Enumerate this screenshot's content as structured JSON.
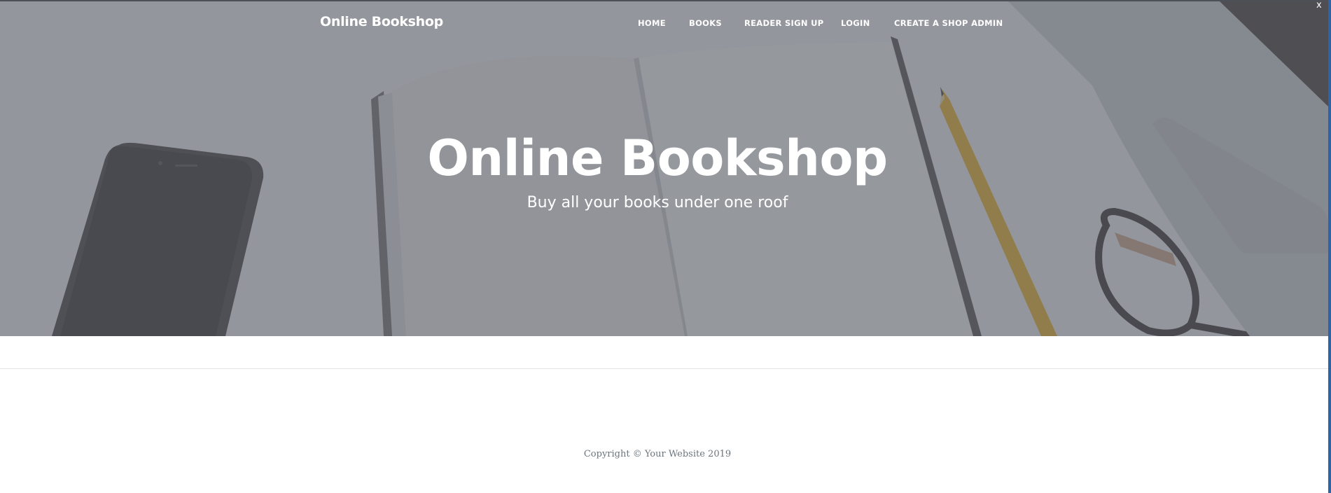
{
  "navbar": {
    "brand": "Online Bookshop",
    "links": [
      {
        "label": "HOME"
      },
      {
        "label": "BOOKS"
      },
      {
        "label": "READER SIGN UP"
      },
      {
        "label": "LOGIN"
      },
      {
        "label": "CREATE A SHOP ADMIN"
      }
    ]
  },
  "hero": {
    "title": "Online Bookshop",
    "subtitle": "Buy all your books under one roof"
  },
  "footer": {
    "copyright": "Copyright © Your Website 2019"
  },
  "window": {
    "close_glyph": "x"
  },
  "colors": {
    "overlay": "#5c5f68",
    "text_on_hero": "#ffffff",
    "footer_text": "#6c757d",
    "window_edge": "#2f63a8"
  },
  "icons": {
    "hero_background": "desk-with-phone-notebook-pencil-glasses-laptop-photo"
  }
}
